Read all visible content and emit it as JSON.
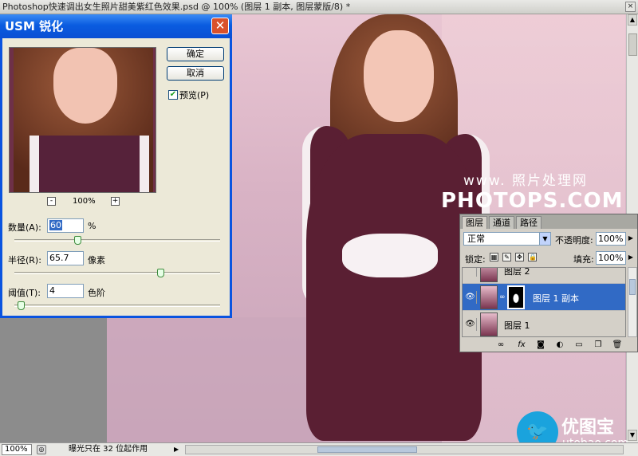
{
  "document": {
    "title": "Photoshop快速调出女生照片甜美紫红色效果.psd @ 100% (图层 1 副本, 图层蒙版/8) *",
    "close_glyph": "×"
  },
  "watermark": {
    "top": "www.   照片处理网",
    "main": "PHOTOPS.COM"
  },
  "logo": {
    "cn": "优图宝",
    "en": "utobao.com"
  },
  "status_bar": {
    "zoom": "100%",
    "message": "曝光只在 32 位起作用"
  },
  "usm_dialog": {
    "title": "USM 锐化",
    "close_glyph": "✕",
    "ok_label": "确定",
    "cancel_label": "取消",
    "preview_label": "预览(P)",
    "preview_checked": true,
    "preview_zoom": "100%",
    "zoom_minus": "-",
    "zoom_plus": "+",
    "amount": {
      "label": "数量(A):",
      "value": "60",
      "unit": "%",
      "slider_fraction": 0.3
    },
    "radius": {
      "label": "半径(R):",
      "value": "65.7",
      "unit": "像素",
      "slider_fraction": 0.72
    },
    "threshold": {
      "label": "阈值(T):",
      "value": "4",
      "unit": "色阶",
      "slider_fraction": 0.016
    }
  },
  "layers_panel": {
    "tabs": [
      "图层",
      "通道",
      "路径"
    ],
    "active_tab": 0,
    "blend_mode": "正常",
    "opacity_label": "不透明度:",
    "opacity": "100%",
    "lock_label": "锁定:",
    "fill_label": "填充:",
    "fill": "100%",
    "layers": [
      {
        "name": "图层 2",
        "visible": false,
        "selected": false,
        "has_mask": false
      },
      {
        "name": "图层 1 副本",
        "visible": true,
        "selected": true,
        "has_mask": true
      },
      {
        "name": "图层 1",
        "visible": true,
        "selected": false,
        "has_mask": false
      }
    ],
    "footer_icons": [
      "link-layers-icon",
      "fx-icon",
      "add-mask-icon",
      "adjustment-layer-icon",
      "new-group-icon",
      "new-layer-icon",
      "delete-layer-icon"
    ]
  },
  "colors": {
    "dialog_title_blue": "#0a5ce0",
    "selected_layer_blue": "#316ac5"
  }
}
